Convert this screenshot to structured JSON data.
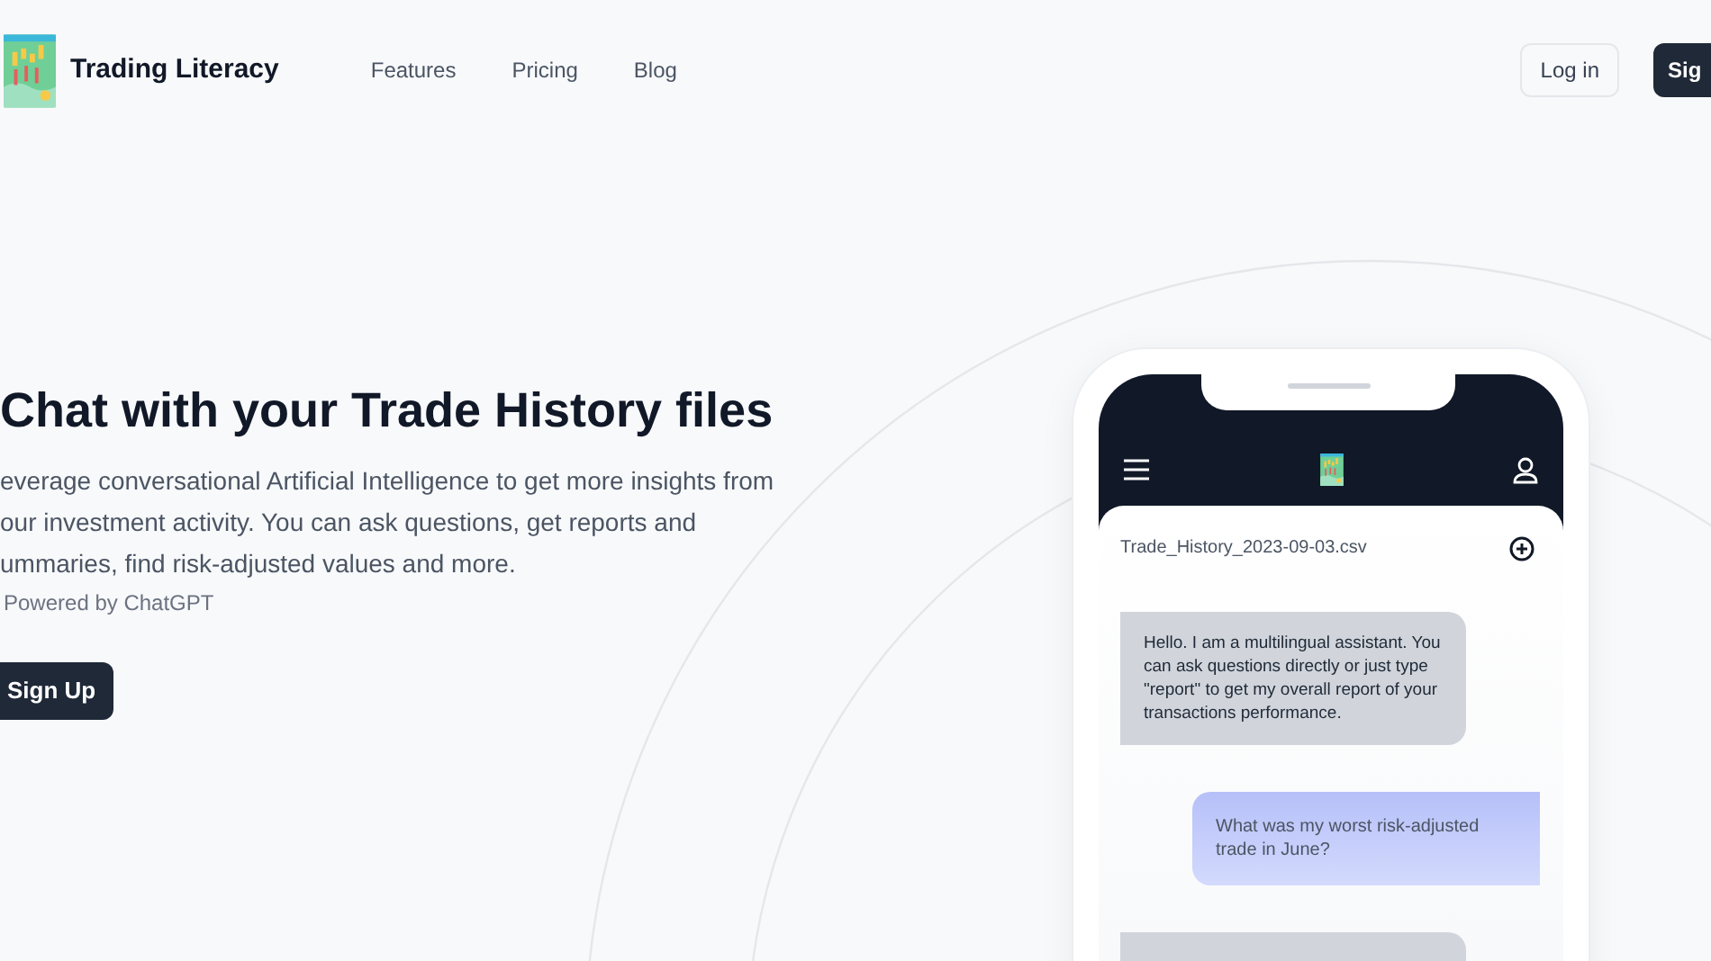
{
  "nav": {
    "brand": "Trading Literacy",
    "links": [
      "Features",
      "Pricing",
      "Blog"
    ],
    "login": "Log in",
    "signup": "Sig"
  },
  "hero": {
    "title": "Chat with your Trade History files",
    "description_lines": [
      "everage conversational Artificial Intelligence to get more insights from",
      "our investment activity. You can ask questions, get reports and",
      "ummaries, find risk-adjusted values and more."
    ],
    "powered_by": "Powered by ChatGPT",
    "cta": "Sign Up"
  },
  "phone": {
    "file_name": "Trade_History_2023-09-03.csv",
    "messages": [
      {
        "kind": "assistant",
        "text": "Hello. I am a multilingual assistant. You can ask questions directly or just type \"report\" to get my overall report of your transactions performance."
      },
      {
        "kind": "user",
        "text": "What was my worst risk-adjusted trade in June?"
      },
      {
        "kind": "assistant"
      }
    ]
  }
}
